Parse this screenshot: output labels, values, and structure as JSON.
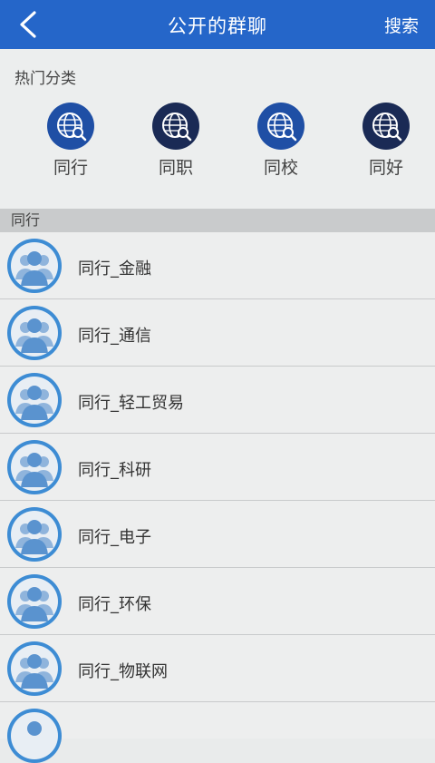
{
  "header": {
    "title": "公开的群聊",
    "search_label": "搜索"
  },
  "categories": {
    "section_label": "热门分类",
    "items": [
      {
        "label": "同行",
        "color": "#1f4fa5"
      },
      {
        "label": "同职",
        "color": "#1a2a55"
      },
      {
        "label": "同校",
        "color": "#1f4fa5"
      },
      {
        "label": "同好",
        "color": "#1a2a55"
      }
    ]
  },
  "group": {
    "header": "同行",
    "rows": [
      {
        "label": "同行_金融"
      },
      {
        "label": "同行_通信"
      },
      {
        "label": "同行_轻工贸易"
      },
      {
        "label": "同行_科研"
      },
      {
        "label": "同行_电子"
      },
      {
        "label": "同行_环保"
      },
      {
        "label": "同行_物联网"
      }
    ]
  },
  "colors": {
    "header_bg": "#2566c9",
    "avatar_bg": "#3d8cd4"
  }
}
